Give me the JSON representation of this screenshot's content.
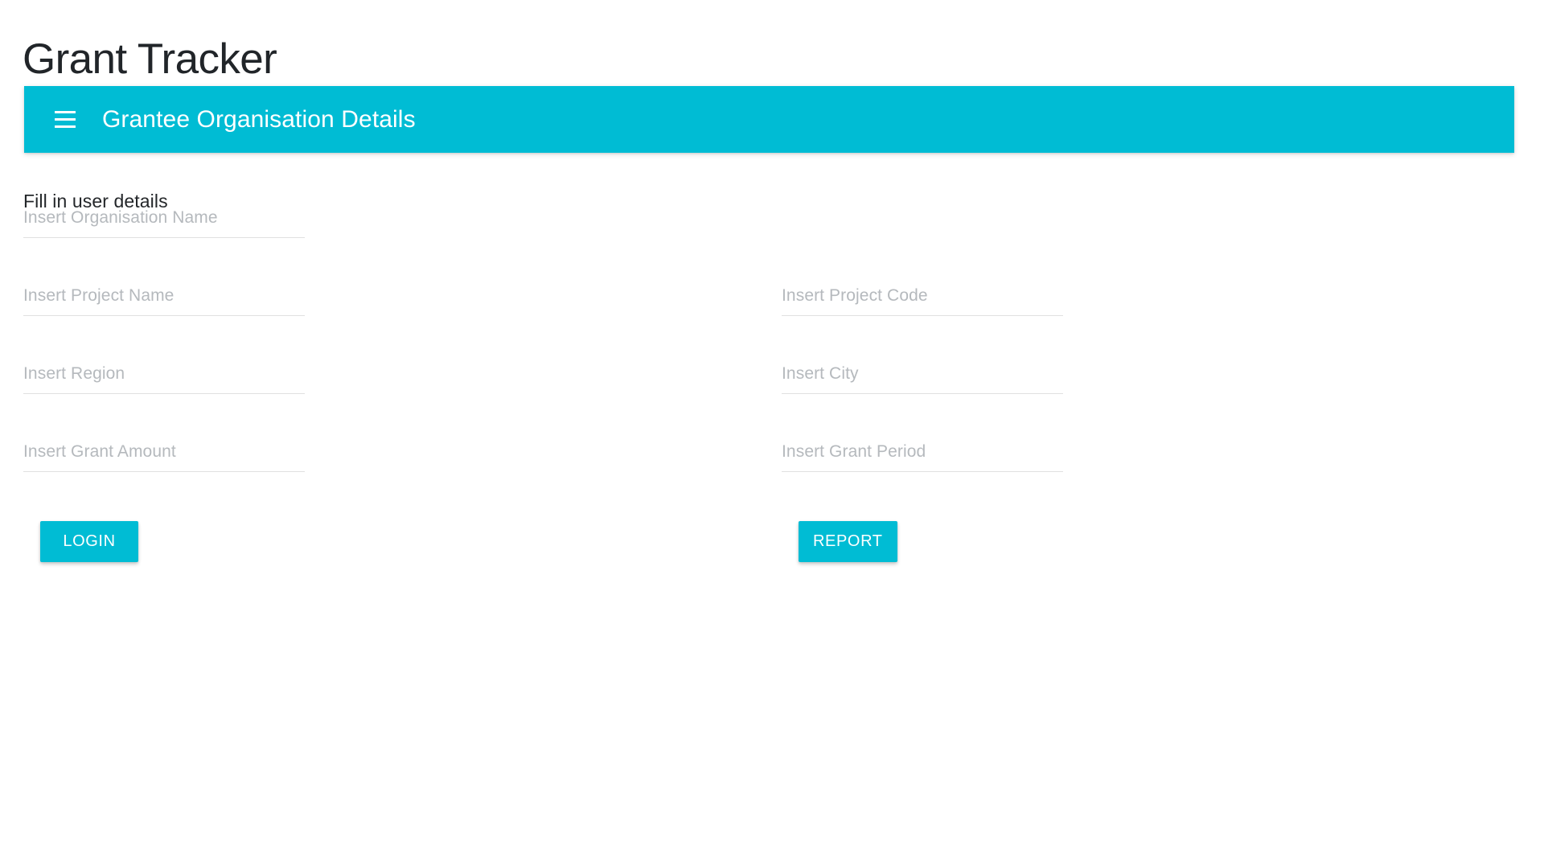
{
  "app": {
    "title": "Grant Tracker"
  },
  "toolbar": {
    "menu_icon": "hamburger-menu-icon",
    "title": "Grantee Organisation Details",
    "background_color": "#00bcd4",
    "text_color": "#ffffff"
  },
  "main": {
    "section_heading": "Fill in user details",
    "fields": [
      {
        "name": "organisation-name",
        "column": "left",
        "row": 0,
        "placeholder": "Insert Organisation Name",
        "value": ""
      },
      {
        "name": "project-name",
        "column": "left",
        "row": 1,
        "placeholder": "Insert Project Name",
        "value": ""
      },
      {
        "name": "project-code",
        "column": "right",
        "row": 1,
        "placeholder": "Insert Project Code",
        "value": ""
      },
      {
        "name": "region",
        "column": "left",
        "row": 2,
        "placeholder": "Insert Region",
        "value": ""
      },
      {
        "name": "city",
        "column": "right",
        "row": 2,
        "placeholder": "Insert City",
        "value": ""
      },
      {
        "name": "grant-amount",
        "column": "left",
        "row": 3,
        "placeholder": "Insert Grant Amount",
        "value": ""
      },
      {
        "name": "grant-period",
        "column": "right",
        "row": 3,
        "placeholder": "Insert Grant Period",
        "value": ""
      }
    ],
    "buttons": {
      "login_label": "LOGIN",
      "report_label": "REPORT",
      "accent_color": "#00bcd4"
    }
  }
}
